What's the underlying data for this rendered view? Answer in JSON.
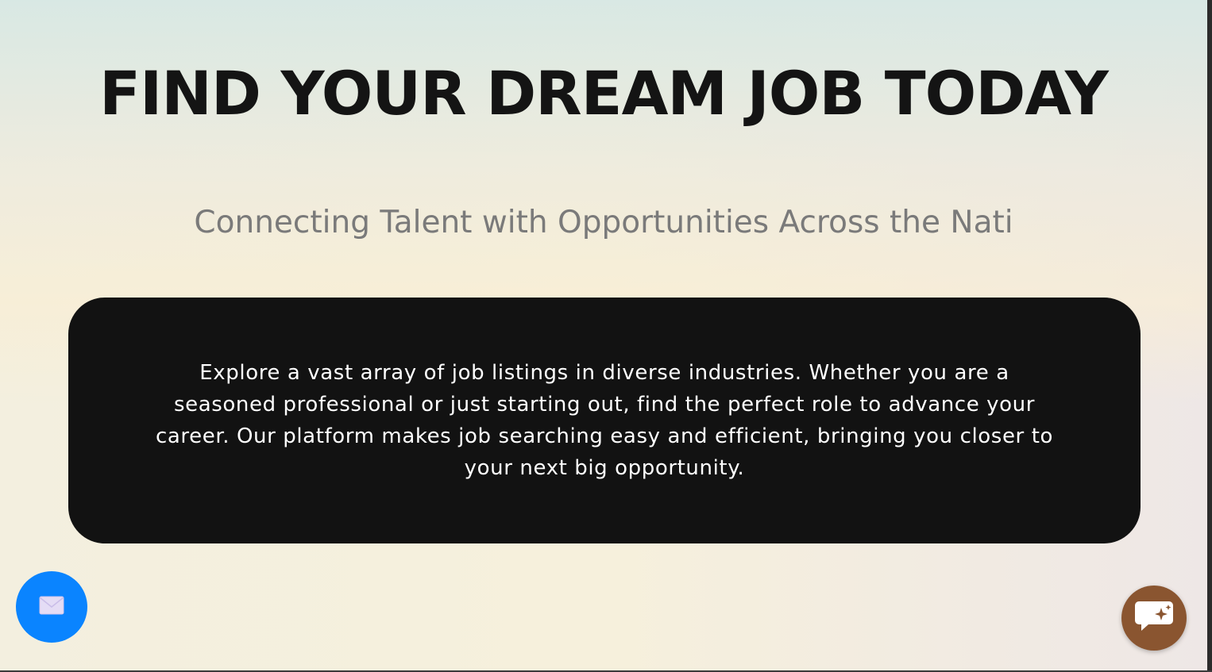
{
  "hero": {
    "title": "FIND YOUR DREAM JOB TODAY",
    "subtitle": "Connecting Talent with Opportunities Across the Nati"
  },
  "info_card": {
    "text": "Explore a vast array of job listings in diverse industries. Whether you are a seasoned professional or just starting out, find the perfect role to advance your career. Our platform makes job searching easy and efficient, bringing you closer to your next big opportunity."
  },
  "floating_buttons": {
    "mail": {
      "icon": "envelope-icon",
      "color": "#0a84ff"
    },
    "chat": {
      "icon": "chat-sparkle-icon",
      "color": "#8a5530"
    }
  },
  "colors": {
    "title": "#141414",
    "subtitle": "#7a7a7a",
    "card_bg": "#121212",
    "card_text": "#ffffff"
  }
}
